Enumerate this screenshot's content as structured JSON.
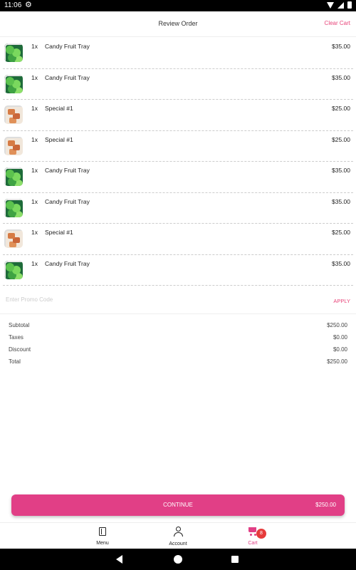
{
  "status_bar": {
    "time": "11:06",
    "gear_glyph": "⚙"
  },
  "header": {
    "title": "Review Order",
    "clear_cart": "Clear Cart"
  },
  "items": [
    {
      "qty": "1x",
      "name": "Candy Fruit Tray",
      "price": "$35.00",
      "image": "veggie-tray"
    },
    {
      "qty": "1x",
      "name": "Candy Fruit Tray",
      "price": "$35.00",
      "image": "veggie-tray"
    },
    {
      "qty": "1x",
      "name": "Special #1",
      "price": "$25.00",
      "image": "special-platter"
    },
    {
      "qty": "1x",
      "name": "Special #1",
      "price": "$25.00",
      "image": "special-platter"
    },
    {
      "qty": "1x",
      "name": "Candy Fruit Tray",
      "price": "$35.00",
      "image": "veggie-tray"
    },
    {
      "qty": "1x",
      "name": "Candy Fruit Tray",
      "price": "$35.00",
      "image": "veggie-tray"
    },
    {
      "qty": "1x",
      "name": "Special #1",
      "price": "$25.00",
      "image": "special-platter"
    },
    {
      "qty": "1x",
      "name": "Candy Fruit Tray",
      "price": "$35.00",
      "image": "veggie-tray"
    }
  ],
  "promo": {
    "placeholder": "Enter Promo Code",
    "value": "",
    "apply": "APPLY"
  },
  "totals": [
    {
      "label": "Subtotal",
      "value": "$250.00"
    },
    {
      "label": "Taxes",
      "value": "$0.00"
    },
    {
      "label": "Discount",
      "value": "$0.00"
    },
    {
      "label": "Total",
      "value": "$250.00"
    }
  ],
  "continue_button": {
    "label": "CONTINUE",
    "price": "$250.00"
  },
  "bottom_nav": {
    "menu": "Menu",
    "account": "Account",
    "cart": "Cart",
    "cart_badge": "8"
  },
  "colors": {
    "accent": "#e13f86",
    "badge": "#e63b3b"
  }
}
